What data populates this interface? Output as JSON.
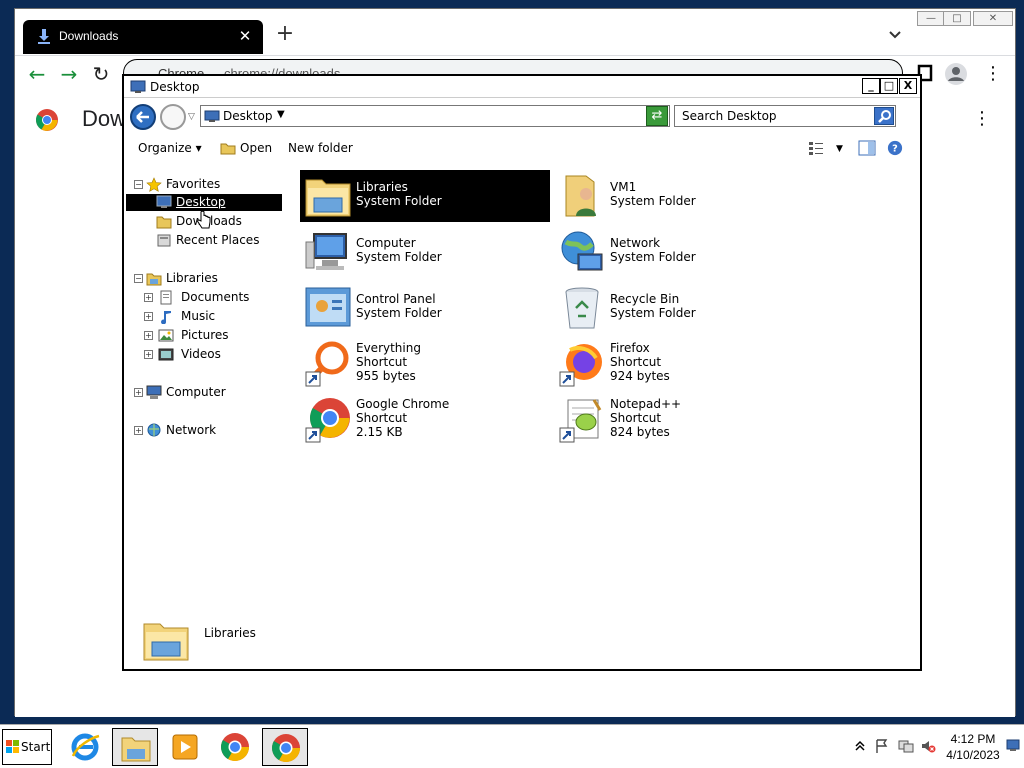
{
  "chrome": {
    "tab_title": "Downloads",
    "tab_close": "✕",
    "new_tab": "+",
    "omnibox_site": "Chrome",
    "omnibox_url": "chrome://downloads",
    "page_heading": "Downloads",
    "kebab": "⋮",
    "back": "←",
    "forward": "→",
    "reload": "↻",
    "window_controls": {
      "minimize": "—",
      "maximize": "□",
      "close": "✕"
    }
  },
  "explorer": {
    "title": "Desktop",
    "address": "Desktop",
    "search_placeholder": "Search Desktop",
    "title_buttons": {
      "minimize": "_",
      "maximize": "□",
      "close": "X"
    },
    "commands": {
      "organize": "Organize",
      "open": "Open",
      "new_folder": "New folder"
    },
    "nav": {
      "favorites": "Favorites",
      "desktop": "Desktop",
      "downloads": "Downloads",
      "recent_places": "Recent Places",
      "libraries": "Libraries",
      "documents": "Documents",
      "music": "Music",
      "pictures": "Pictures",
      "videos": "Videos",
      "computer": "Computer",
      "network": "Network"
    },
    "files": [
      {
        "name": "Libraries",
        "line2": "System Folder",
        "line3": ""
      },
      {
        "name": "VM1",
        "line2": "System Folder",
        "line3": ""
      },
      {
        "name": "Computer",
        "line2": "System Folder",
        "line3": ""
      },
      {
        "name": "Network",
        "line2": "System Folder",
        "line3": ""
      },
      {
        "name": "Control Panel",
        "line2": "System Folder",
        "line3": ""
      },
      {
        "name": "Recycle Bin",
        "line2": "System Folder",
        "line3": ""
      },
      {
        "name": "Everything",
        "line2": "Shortcut",
        "line3": "955 bytes"
      },
      {
        "name": "Firefox",
        "line2": "Shortcut",
        "line3": "924 bytes"
      },
      {
        "name": "Google Chrome",
        "line2": "Shortcut",
        "line3": "2.15 KB"
      },
      {
        "name": "Notepad++",
        "line2": "Shortcut",
        "line3": "824 bytes"
      }
    ],
    "details_name": "Libraries"
  },
  "taskbar": {
    "start": "Start",
    "time": "4:12 PM",
    "date": "4/10/2023"
  },
  "colors": {
    "desktop": "#0b2a55",
    "selection": "#000000",
    "chrome_red": "#db4437",
    "chrome_green": "#0f9d58",
    "chrome_yellow": "#f4b400",
    "chrome_blue": "#4285f4"
  }
}
